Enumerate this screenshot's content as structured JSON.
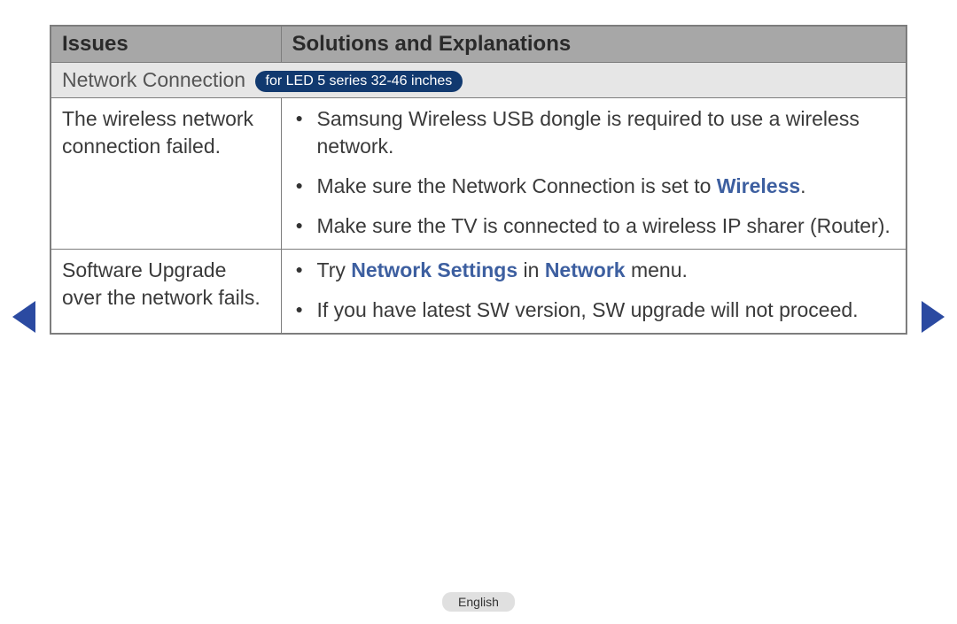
{
  "header": {
    "issues": "Issues",
    "solutions": "Solutions and Explanations"
  },
  "section": {
    "title": "Network Connection",
    "badge": "for LED 5 series 32-46 inches"
  },
  "rows": [
    {
      "issue": "The wireless network connection failed.",
      "solutions": {
        "s1": "Samsung Wireless USB dongle is required to use a wireless network.",
        "s2_pre": "Make sure the Network Connection is set to ",
        "s2_hl": "Wireless",
        "s2_post": ".",
        "s3": "Make sure the TV is connected to a wireless IP sharer (Router)."
      }
    },
    {
      "issue": "Software Upgrade over the network fails.",
      "solutions": {
        "s1_pre": "Try ",
        "s1_hl1": "Network Settings",
        "s1_mid": " in ",
        "s1_hl2": "Network",
        "s1_post": " menu.",
        "s2": "If you have latest SW version, SW upgrade will not proceed."
      }
    }
  ],
  "footer": {
    "language": "English"
  }
}
